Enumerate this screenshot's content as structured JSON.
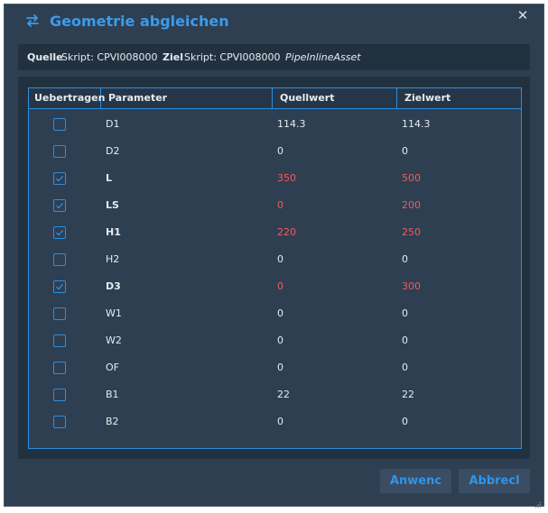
{
  "window": {
    "title": "Geometrie abgleichen",
    "title_icon": "swap-arrows-icon",
    "close_icon": "close-icon",
    "close_glyph": "✕"
  },
  "info": {
    "source_label": "Quelle",
    "source_value": "Skript: CPVI008000",
    "target_label": "Ziel",
    "target_value": "Skript: CPVI008000",
    "asset_type": "PipeInlineAsset"
  },
  "table": {
    "columns": [
      "Uebertragen",
      "Parameter",
      "Quellwert",
      "Zielwert"
    ],
    "rows": [
      {
        "checked": false,
        "parameter": "D1",
        "source": "114.3",
        "target": "114.3",
        "changed": false
      },
      {
        "checked": false,
        "parameter": "D2",
        "source": "0",
        "target": "0",
        "changed": false
      },
      {
        "checked": true,
        "parameter": "L",
        "source": "350",
        "target": "500",
        "changed": true
      },
      {
        "checked": true,
        "parameter": "LS",
        "source": "0",
        "target": "200",
        "changed": true
      },
      {
        "checked": true,
        "parameter": "H1",
        "source": "220",
        "target": "250",
        "changed": true
      },
      {
        "checked": false,
        "parameter": "H2",
        "source": "0",
        "target": "0",
        "changed": false
      },
      {
        "checked": true,
        "parameter": "D3",
        "source": "0",
        "target": "300",
        "changed": true
      },
      {
        "checked": false,
        "parameter": "W1",
        "source": "0",
        "target": "0",
        "changed": false
      },
      {
        "checked": false,
        "parameter": "W2",
        "source": "0",
        "target": "0",
        "changed": false
      },
      {
        "checked": false,
        "parameter": "OF",
        "source": "0",
        "target": "0",
        "changed": false
      },
      {
        "checked": false,
        "parameter": "B1",
        "source": "22",
        "target": "22",
        "changed": false
      },
      {
        "checked": false,
        "parameter": "B2",
        "source": "0",
        "target": "0",
        "changed": false
      }
    ]
  },
  "buttons": {
    "apply_label": "Anwenc",
    "cancel_label": "Abbrecl"
  },
  "colors": {
    "accent": "#2f95ea",
    "changed_value": "#f25b5b",
    "background": "#2e3f52",
    "panel": "#223140"
  }
}
